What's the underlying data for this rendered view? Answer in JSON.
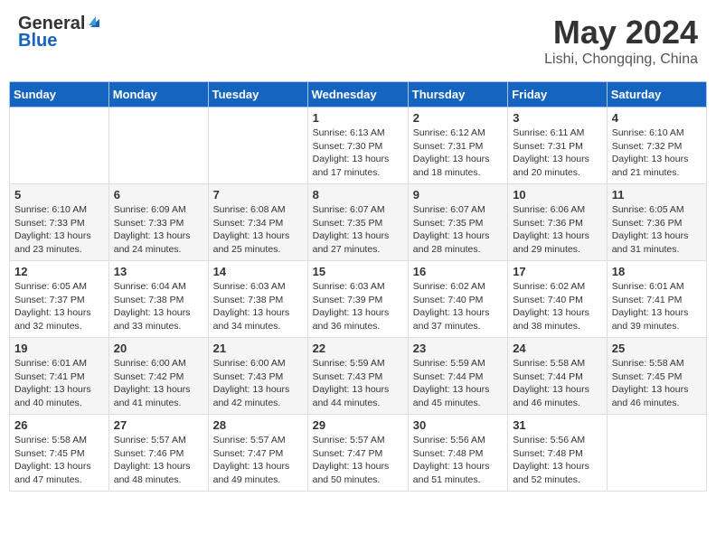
{
  "header": {
    "logo_general": "General",
    "logo_blue": "Blue",
    "month": "May 2024",
    "location": "Lishi, Chongqing, China"
  },
  "weekdays": [
    "Sunday",
    "Monday",
    "Tuesday",
    "Wednesday",
    "Thursday",
    "Friday",
    "Saturday"
  ],
  "weeks": [
    [
      {
        "day": "",
        "info": ""
      },
      {
        "day": "",
        "info": ""
      },
      {
        "day": "",
        "info": ""
      },
      {
        "day": "1",
        "info": "Sunrise: 6:13 AM\nSunset: 7:30 PM\nDaylight: 13 hours\nand 17 minutes."
      },
      {
        "day": "2",
        "info": "Sunrise: 6:12 AM\nSunset: 7:31 PM\nDaylight: 13 hours\nand 18 minutes."
      },
      {
        "day": "3",
        "info": "Sunrise: 6:11 AM\nSunset: 7:31 PM\nDaylight: 13 hours\nand 20 minutes."
      },
      {
        "day": "4",
        "info": "Sunrise: 6:10 AM\nSunset: 7:32 PM\nDaylight: 13 hours\nand 21 minutes."
      }
    ],
    [
      {
        "day": "5",
        "info": "Sunrise: 6:10 AM\nSunset: 7:33 PM\nDaylight: 13 hours\nand 23 minutes."
      },
      {
        "day": "6",
        "info": "Sunrise: 6:09 AM\nSunset: 7:33 PM\nDaylight: 13 hours\nand 24 minutes."
      },
      {
        "day": "7",
        "info": "Sunrise: 6:08 AM\nSunset: 7:34 PM\nDaylight: 13 hours\nand 25 minutes."
      },
      {
        "day": "8",
        "info": "Sunrise: 6:07 AM\nSunset: 7:35 PM\nDaylight: 13 hours\nand 27 minutes."
      },
      {
        "day": "9",
        "info": "Sunrise: 6:07 AM\nSunset: 7:35 PM\nDaylight: 13 hours\nand 28 minutes."
      },
      {
        "day": "10",
        "info": "Sunrise: 6:06 AM\nSunset: 7:36 PM\nDaylight: 13 hours\nand 29 minutes."
      },
      {
        "day": "11",
        "info": "Sunrise: 6:05 AM\nSunset: 7:36 PM\nDaylight: 13 hours\nand 31 minutes."
      }
    ],
    [
      {
        "day": "12",
        "info": "Sunrise: 6:05 AM\nSunset: 7:37 PM\nDaylight: 13 hours\nand 32 minutes."
      },
      {
        "day": "13",
        "info": "Sunrise: 6:04 AM\nSunset: 7:38 PM\nDaylight: 13 hours\nand 33 minutes."
      },
      {
        "day": "14",
        "info": "Sunrise: 6:03 AM\nSunset: 7:38 PM\nDaylight: 13 hours\nand 34 minutes."
      },
      {
        "day": "15",
        "info": "Sunrise: 6:03 AM\nSunset: 7:39 PM\nDaylight: 13 hours\nand 36 minutes."
      },
      {
        "day": "16",
        "info": "Sunrise: 6:02 AM\nSunset: 7:40 PM\nDaylight: 13 hours\nand 37 minutes."
      },
      {
        "day": "17",
        "info": "Sunrise: 6:02 AM\nSunset: 7:40 PM\nDaylight: 13 hours\nand 38 minutes."
      },
      {
        "day": "18",
        "info": "Sunrise: 6:01 AM\nSunset: 7:41 PM\nDaylight: 13 hours\nand 39 minutes."
      }
    ],
    [
      {
        "day": "19",
        "info": "Sunrise: 6:01 AM\nSunset: 7:41 PM\nDaylight: 13 hours\nand 40 minutes."
      },
      {
        "day": "20",
        "info": "Sunrise: 6:00 AM\nSunset: 7:42 PM\nDaylight: 13 hours\nand 41 minutes."
      },
      {
        "day": "21",
        "info": "Sunrise: 6:00 AM\nSunset: 7:43 PM\nDaylight: 13 hours\nand 42 minutes."
      },
      {
        "day": "22",
        "info": "Sunrise: 5:59 AM\nSunset: 7:43 PM\nDaylight: 13 hours\nand 44 minutes."
      },
      {
        "day": "23",
        "info": "Sunrise: 5:59 AM\nSunset: 7:44 PM\nDaylight: 13 hours\nand 45 minutes."
      },
      {
        "day": "24",
        "info": "Sunrise: 5:58 AM\nSunset: 7:44 PM\nDaylight: 13 hours\nand 46 minutes."
      },
      {
        "day": "25",
        "info": "Sunrise: 5:58 AM\nSunset: 7:45 PM\nDaylight: 13 hours\nand 46 minutes."
      }
    ],
    [
      {
        "day": "26",
        "info": "Sunrise: 5:58 AM\nSunset: 7:45 PM\nDaylight: 13 hours\nand 47 minutes."
      },
      {
        "day": "27",
        "info": "Sunrise: 5:57 AM\nSunset: 7:46 PM\nDaylight: 13 hours\nand 48 minutes."
      },
      {
        "day": "28",
        "info": "Sunrise: 5:57 AM\nSunset: 7:47 PM\nDaylight: 13 hours\nand 49 minutes."
      },
      {
        "day": "29",
        "info": "Sunrise: 5:57 AM\nSunset: 7:47 PM\nDaylight: 13 hours\nand 50 minutes."
      },
      {
        "day": "30",
        "info": "Sunrise: 5:56 AM\nSunset: 7:48 PM\nDaylight: 13 hours\nand 51 minutes."
      },
      {
        "day": "31",
        "info": "Sunrise: 5:56 AM\nSunset: 7:48 PM\nDaylight: 13 hours\nand 52 minutes."
      },
      {
        "day": "",
        "info": ""
      }
    ]
  ]
}
